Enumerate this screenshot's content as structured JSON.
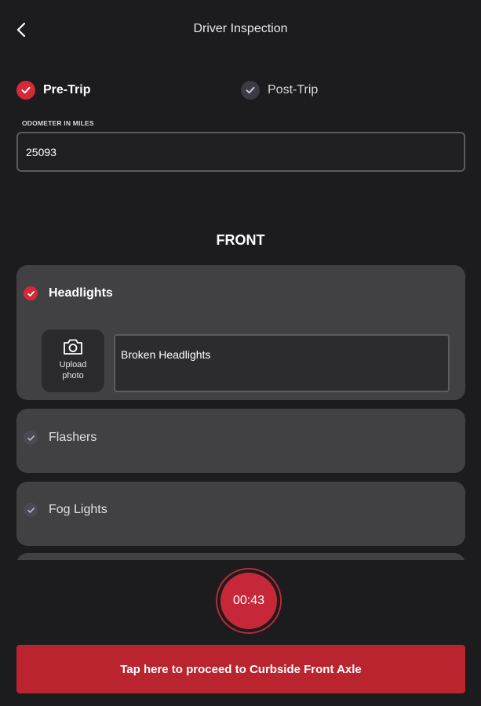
{
  "header": {
    "title": "Driver Inspection",
    "back_icon": "chevron-left-icon"
  },
  "trip_type": {
    "options": [
      {
        "label": "Pre-Trip",
        "selected": true
      },
      {
        "label": "Post-Trip",
        "selected": false
      }
    ]
  },
  "odometer": {
    "label": "ODOMETER IN MILES",
    "value": "25093"
  },
  "section": {
    "title": "FRONT",
    "items": [
      {
        "label": "Headlights",
        "checked": true,
        "expanded": true,
        "upload_label": "Upload photo",
        "upload_icon": "camera-icon",
        "note": "Broken Headlights"
      },
      {
        "label": "Flashers",
        "checked": false,
        "expanded": false
      },
      {
        "label": "Fog Lights",
        "checked": false,
        "expanded": false
      }
    ]
  },
  "timer": {
    "value": "00:43"
  },
  "proceed_button": {
    "label": "Tap here to proceed to Curbside Front Axle"
  },
  "colors": {
    "background": "#1c1b1d",
    "card": "#414043",
    "accent_red": "#d42a37",
    "button_red": "#b9242f",
    "unchecked": "#4a4a55"
  }
}
